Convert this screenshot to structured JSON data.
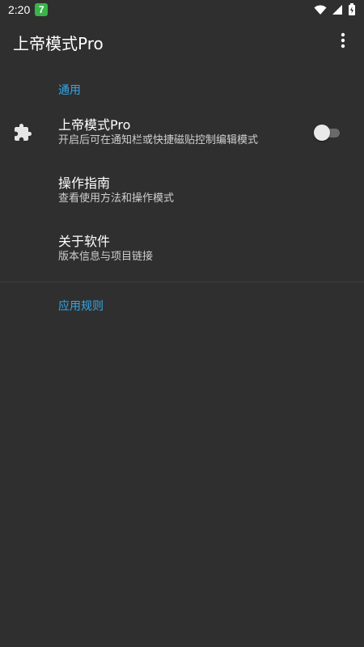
{
  "status_bar": {
    "time": "2:20",
    "badge": "7",
    "icons": [
      "wifi-icon",
      "signal-icon",
      "battery-icon"
    ]
  },
  "app_bar": {
    "title": "上帝模式Pro",
    "overflow_icon": "more-vert-icon"
  },
  "colors": {
    "background": "#2f2f2f",
    "accent": "#35a7e6",
    "badge": "#39b54a"
  },
  "sections": [
    {
      "header": "通用",
      "items": [
        {
          "title": "上帝模式Pro",
          "summary": "开启后可在通知栏或快捷磁贴控制编辑模式",
          "icon": "puzzle-icon",
          "toggle": false
        },
        {
          "title": "操作指南",
          "summary": "查看使用方法和操作模式"
        },
        {
          "title": "关于软件",
          "summary": "版本信息与项目链接"
        }
      ]
    },
    {
      "header": "应用规则",
      "items": []
    }
  ]
}
